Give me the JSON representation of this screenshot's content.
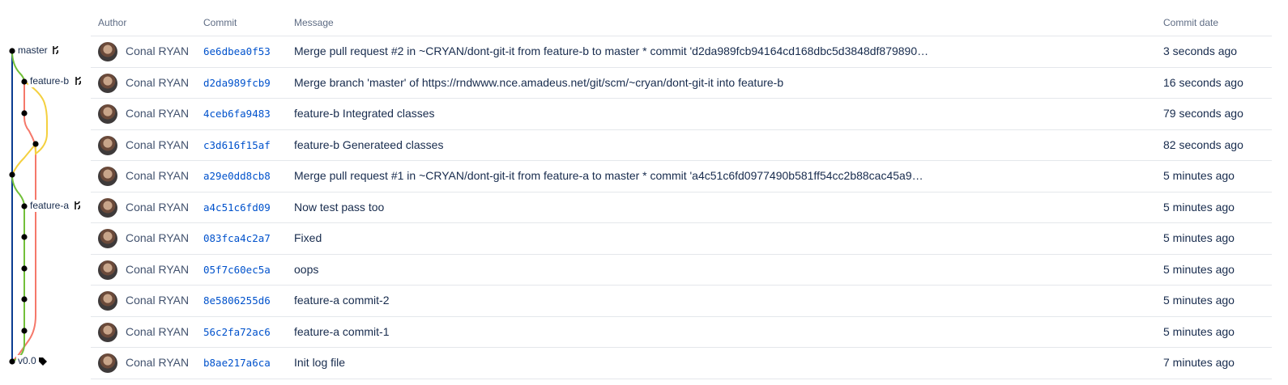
{
  "header": {
    "author": "Author",
    "commit": "Commit",
    "message": "Message",
    "commit_date": "Commit date"
  },
  "graph": {
    "colors": {
      "master": "#0b3d91",
      "feature_a": "#72c03a",
      "feature_b": "#f4d03f",
      "red": "#f5786a"
    },
    "labels": {
      "master": "master",
      "feature_b": "feature-b",
      "feature_a": "feature-a",
      "tag": "v0.0"
    }
  },
  "commits": [
    {
      "author": "Conal RYAN",
      "hash": "6e6dbea0f53",
      "message": "Merge pull request #2 in ~CRYAN/dont-git-it from feature-b to master * commit 'd2da989fcb94164cd168dbc5d3848df879890…",
      "date": "3 seconds ago"
    },
    {
      "author": "Conal RYAN",
      "hash": "d2da989fcb9",
      "message": "Merge branch 'master' of https://rndwww.nce.amadeus.net/git/scm/~cryan/dont-git-it into feature-b",
      "date": "16 seconds ago"
    },
    {
      "author": "Conal RYAN",
      "hash": "4ceb6fa9483",
      "message": "feature-b Integrated classes",
      "date": "79 seconds ago"
    },
    {
      "author": "Conal RYAN",
      "hash": "c3d616f15af",
      "message": "feature-b Generateed classes",
      "date": "82 seconds ago"
    },
    {
      "author": "Conal RYAN",
      "hash": "a29e0dd8cb8",
      "message": "Merge pull request #1 in ~CRYAN/dont-git-it from feature-a to master * commit 'a4c51c6fd0977490b581ff54cc2b88cac45a9…",
      "date": "5 minutes ago"
    },
    {
      "author": "Conal RYAN",
      "hash": "a4c51c6fd09",
      "message": "Now test pass too",
      "date": "5 minutes ago"
    },
    {
      "author": "Conal RYAN",
      "hash": "083fca4c2a7",
      "message": "Fixed",
      "date": "5 minutes ago"
    },
    {
      "author": "Conal RYAN",
      "hash": "05f7c60ec5a",
      "message": "oops",
      "date": "5 minutes ago"
    },
    {
      "author": "Conal RYAN",
      "hash": "8e5806255d6",
      "message": "feature-a commit-2",
      "date": "5 minutes ago"
    },
    {
      "author": "Conal RYAN",
      "hash": "56c2fa72ac6",
      "message": "feature-a commit-1",
      "date": "5 minutes ago"
    },
    {
      "author": "Conal RYAN",
      "hash": "b8ae217a6ca",
      "message": "Init log file",
      "date": "7 minutes ago"
    }
  ]
}
